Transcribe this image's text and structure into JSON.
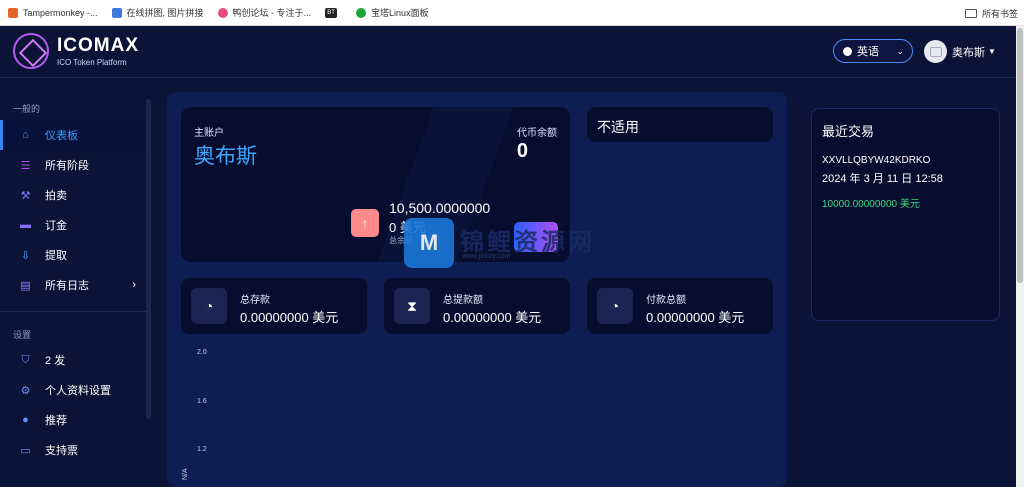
{
  "bookmarks": {
    "items": [
      {
        "label": "Tampermonkey -...",
        "icon": "tampermonkey-icon",
        "color": "#e8642c"
      },
      {
        "label": "在线拼图, 图片拼接",
        "icon": "puzzle-icon",
        "color": "#3c7bdc"
      },
      {
        "label": "鸭创论坛 - 专注于...",
        "icon": "duck-icon",
        "color": "#e84a7a"
      },
      {
        "label": "",
        "icon": "bt-icon",
        "color": "#222222",
        "badge": "BT"
      },
      {
        "label": "宝塔Linux面板",
        "icon": "shield-icon",
        "color": "#20a53a"
      }
    ],
    "all_bookmarks": "所有书签"
  },
  "header": {
    "logo_title": "ICOMAX",
    "logo_subtitle": "ICO Token Platform",
    "language": "英语",
    "user_name": "奥布斯"
  },
  "sidebar": {
    "general_label": "一般的",
    "settings_label": "设置",
    "items": [
      {
        "label": "仪表板",
        "icon": "home-icon",
        "active": true
      },
      {
        "label": "所有阶段",
        "icon": "list-icon"
      },
      {
        "label": "拍卖",
        "icon": "gavel-icon"
      },
      {
        "label": "订金",
        "icon": "wallet-icon"
      },
      {
        "label": "提取",
        "icon": "withdraw-icon"
      },
      {
        "label": "所有日志",
        "icon": "file-icon"
      },
      {
        "label": "2 发",
        "icon": "shield-icon"
      },
      {
        "label": "个人资料设置",
        "icon": "user-settings-icon"
      },
      {
        "label": "推荐",
        "icon": "user-icon"
      },
      {
        "label": "支持票",
        "icon": "ticket-icon"
      }
    ]
  },
  "main_card": {
    "account_label": "主账户",
    "account_name": "奥布斯",
    "token_balance_label": "代币余额",
    "token_balance": "0",
    "amount": "10,500.0000000",
    "usd": "0 美元",
    "total_label": "总余额"
  },
  "not_applicable": "不适用",
  "stats": [
    {
      "label": "总存款",
      "value": "0.00000000 美元",
      "icon": "piggy-bank-icon"
    },
    {
      "label": "总提款额",
      "value": "0.00000000 美元",
      "icon": "hourglass-icon"
    },
    {
      "label": "付款总额",
      "value": "0.00000000 美元",
      "icon": "piggy-bank-icon"
    }
  ],
  "chart": {
    "y_ticks": [
      "2.0",
      "1.6",
      "1.2"
    ],
    "y_label": "N/A"
  },
  "recent": {
    "title": "最近交易",
    "tx_id": "XXVLLQBYW42KDRKO",
    "date": "2024 年 3 月 11 日 12:58",
    "amount": "10000.00000000 美元"
  },
  "watermark": {
    "text": "锦鲤资源网",
    "url": "www.jinlizy.com"
  },
  "colors": {
    "background": "#0b1437",
    "accent": "#3ba7ff",
    "positive": "#3ddc84"
  }
}
